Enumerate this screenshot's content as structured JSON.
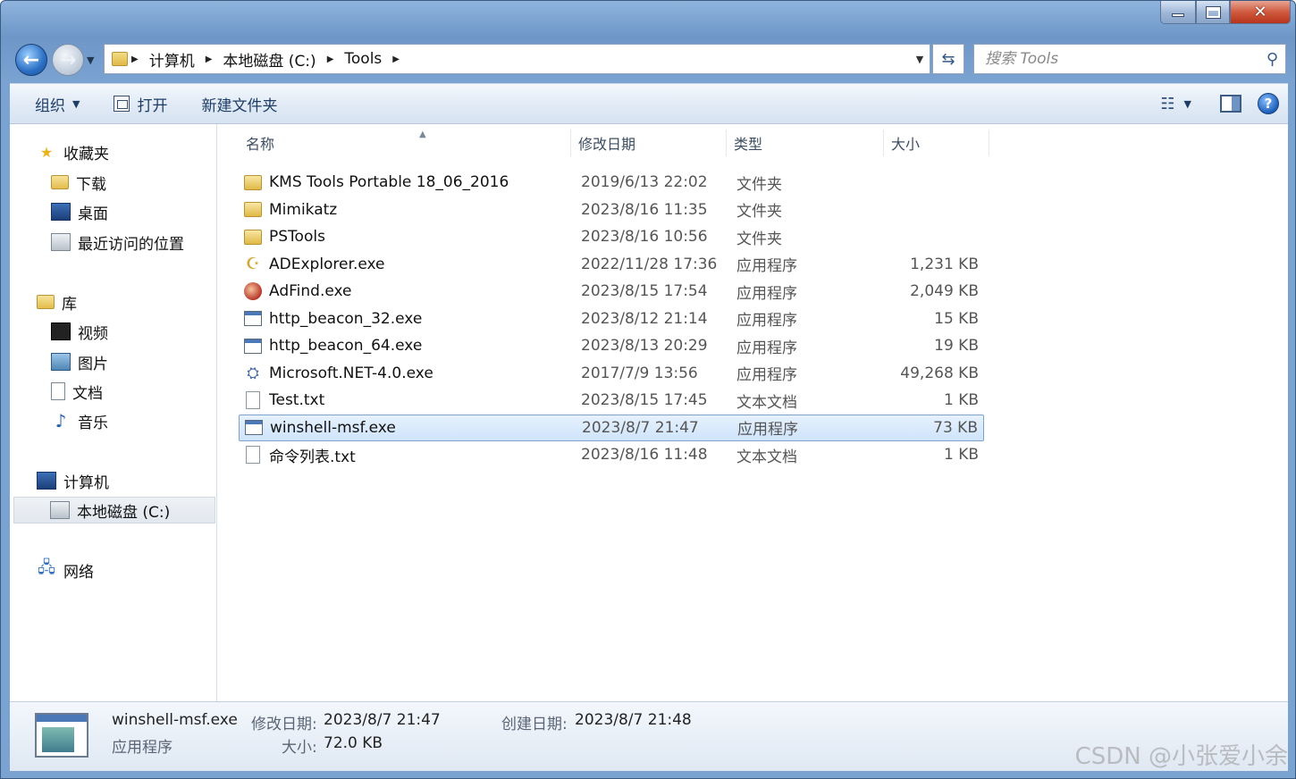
{
  "window": {
    "min_label": "",
    "max_label": "",
    "close_label": "✕"
  },
  "address": {
    "crumbs": [
      "计算机",
      "本地磁盘 (C:)",
      "Tools"
    ]
  },
  "search": {
    "placeholder": "搜索 Tools"
  },
  "toolbar": {
    "organize": "组织",
    "open": "打开",
    "new_folder": "新建文件夹"
  },
  "nav": {
    "favorites": "收藏夹",
    "downloads": "下载",
    "desktop": "桌面",
    "recent": "最近访问的位置",
    "libraries": "库",
    "videos": "视频",
    "pictures": "图片",
    "documents": "文档",
    "music": "音乐",
    "computer": "计算机",
    "local_disk": "本地磁盘 (C:)",
    "network": "网络"
  },
  "columns": {
    "name": "名称",
    "date": "修改日期",
    "type": "类型",
    "size": "大小"
  },
  "files": [
    {
      "name": "KMS Tools Portable 18_06_2016",
      "date": "2019/6/13 22:02",
      "type": "文件夹",
      "size": "",
      "icon": "folder-icon"
    },
    {
      "name": "Mimikatz",
      "date": "2023/8/16 11:35",
      "type": "文件夹",
      "size": "",
      "icon": "folder-icon"
    },
    {
      "name": "PSTools",
      "date": "2023/8/16 10:56",
      "type": "文件夹",
      "size": "",
      "icon": "folder-icon"
    },
    {
      "name": "ADExplorer.exe",
      "date": "2022/11/28 17:36",
      "type": "应用程序",
      "size": "1,231 KB",
      "icon": "adexplorer-icon"
    },
    {
      "name": "AdFind.exe",
      "date": "2023/8/15 17:54",
      "type": "应用程序",
      "size": "2,049 KB",
      "icon": "adfind-icon"
    },
    {
      "name": "http_beacon_32.exe",
      "date": "2023/8/12 21:14",
      "type": "应用程序",
      "size": "15 KB",
      "icon": "exe-icon"
    },
    {
      "name": "http_beacon_64.exe",
      "date": "2023/8/13 20:29",
      "type": "应用程序",
      "size": "19 KB",
      "icon": "exe-icon"
    },
    {
      "name": "Microsoft.NET-4.0.exe",
      "date": "2017/7/9 13:56",
      "type": "应用程序",
      "size": "49,268 KB",
      "icon": "installer-icon"
    },
    {
      "name": "Test.txt",
      "date": "2023/8/15 17:45",
      "type": "文本文档",
      "size": "1 KB",
      "icon": "text-file-icon"
    },
    {
      "name": "winshell-msf.exe",
      "date": "2023/8/7 21:47",
      "type": "应用程序",
      "size": "73 KB",
      "icon": "exe-icon",
      "selected": true
    },
    {
      "name": "命令列表.txt",
      "date": "2023/8/16 11:48",
      "type": "文本文档",
      "size": "1 KB",
      "icon": "text-file-icon"
    }
  ],
  "details": {
    "filename": "winshell-msf.exe",
    "modified_label": "修改日期:",
    "modified": "2023/8/7 21:47",
    "created_label": "创建日期:",
    "created": "2023/8/7 21:48",
    "type": "应用程序",
    "size_label": "大小:",
    "size": "72.0 KB"
  },
  "watermark": "CSDN @小张爱小余"
}
